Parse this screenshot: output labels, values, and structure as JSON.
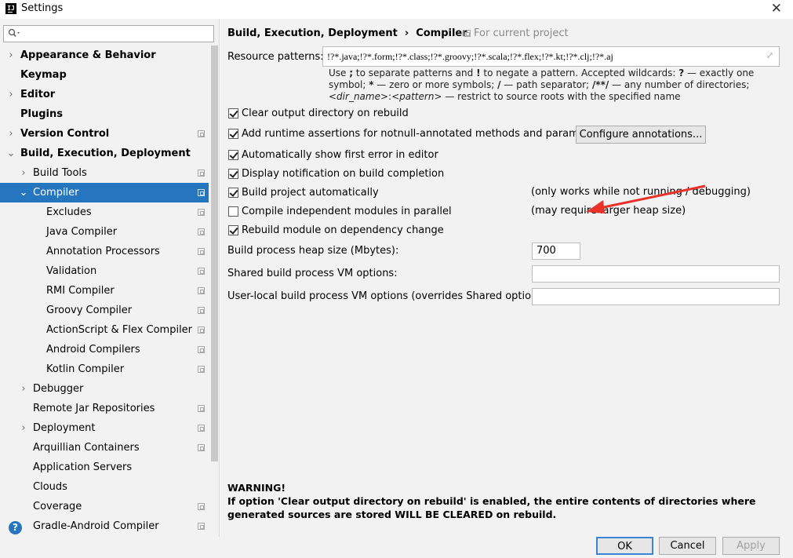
{
  "window": {
    "app_icon_text": "IJ",
    "title": "Settings",
    "close_glyph": "✕"
  },
  "search": {
    "placeholder": "",
    "value": ""
  },
  "tree": [
    {
      "label": "Appearance & Behavior",
      "bold": true,
      "arrow": "›",
      "level": 0,
      "project_icon": false
    },
    {
      "label": "Keymap",
      "bold": true,
      "arrow": "",
      "level": 0,
      "project_icon": false
    },
    {
      "label": "Editor",
      "bold": true,
      "arrow": "›",
      "level": 0,
      "project_icon": false
    },
    {
      "label": "Plugins",
      "bold": true,
      "arrow": "",
      "level": 0,
      "project_icon": false
    },
    {
      "label": "Version Control",
      "bold": true,
      "arrow": "›",
      "level": 0,
      "project_icon": true
    },
    {
      "label": "Build, Execution, Deployment",
      "bold": true,
      "arrow": "⌄",
      "level": 0,
      "project_icon": false
    },
    {
      "label": "Build Tools",
      "bold": false,
      "arrow": "›",
      "level": 1,
      "project_icon": true
    },
    {
      "label": "Compiler",
      "bold": false,
      "arrow": "⌄",
      "level": 1,
      "project_icon": true,
      "selected": true
    },
    {
      "label": "Excludes",
      "bold": false,
      "arrow": "",
      "level": 2,
      "project_icon": true
    },
    {
      "label": "Java Compiler",
      "bold": false,
      "arrow": "",
      "level": 2,
      "project_icon": true
    },
    {
      "label": "Annotation Processors",
      "bold": false,
      "arrow": "",
      "level": 2,
      "project_icon": true
    },
    {
      "label": "Validation",
      "bold": false,
      "arrow": "",
      "level": 2,
      "project_icon": true
    },
    {
      "label": "RMI Compiler",
      "bold": false,
      "arrow": "",
      "level": 2,
      "project_icon": true
    },
    {
      "label": "Groovy Compiler",
      "bold": false,
      "arrow": "",
      "level": 2,
      "project_icon": true
    },
    {
      "label": "ActionScript & Flex Compiler",
      "bold": false,
      "arrow": "",
      "level": 2,
      "project_icon": true
    },
    {
      "label": "Android Compilers",
      "bold": false,
      "arrow": "",
      "level": 2,
      "project_icon": true
    },
    {
      "label": "Kotlin Compiler",
      "bold": false,
      "arrow": "",
      "level": 2,
      "project_icon": true
    },
    {
      "label": "Debugger",
      "bold": false,
      "arrow": "›",
      "level": 1,
      "project_icon": false
    },
    {
      "label": "Remote Jar Repositories",
      "bold": false,
      "arrow": "",
      "level": 1,
      "project_icon": true
    },
    {
      "label": "Deployment",
      "bold": false,
      "arrow": "›",
      "level": 1,
      "project_icon": true
    },
    {
      "label": "Arquillian Containers",
      "bold": false,
      "arrow": "",
      "level": 1,
      "project_icon": true
    },
    {
      "label": "Application Servers",
      "bold": false,
      "arrow": "",
      "level": 1,
      "project_icon": false
    },
    {
      "label": "Clouds",
      "bold": false,
      "arrow": "",
      "level": 1,
      "project_icon": false
    },
    {
      "label": "Coverage",
      "bold": false,
      "arrow": "",
      "level": 1,
      "project_icon": true
    },
    {
      "label": "Gradle-Android Compiler",
      "bold": false,
      "arrow": "",
      "level": 1,
      "project_icon": true
    }
  ],
  "help": {
    "glyph": "?"
  },
  "header": {
    "crumb_parent": "Build, Execution, Deployment",
    "crumb_sep": "›",
    "crumb_current": "Compiler",
    "for_project": "For current project"
  },
  "resource": {
    "label": "Resource patterns:",
    "value": "!?*.java;!?*.form;!?*.class;!?*.groovy;!?*.scala;!?*.flex;!?*.kt;!?*.clj;!?*.aj",
    "expand_glyph": "⤢",
    "hint": {
      "p1": "Use ",
      "semicolon": ";",
      "p2": " to separate patterns and ",
      "bang": "!",
      "p3": " to negate a pattern. Accepted wildcards: ",
      "q": "?",
      "p4": " — exactly one symbol; ",
      "star": "*",
      "p5": " — zero or more symbols; ",
      "slash": "/",
      "p6": " — path separator; ",
      "dstar": "/**/",
      "p7": " — any number of directories; ",
      "dirname": "<dir_name>",
      "colon": ":",
      "pattern": "<pattern>",
      "p8": " — restrict to source roots with the specified name"
    }
  },
  "options": [
    {
      "label": "Clear output directory on rebuild",
      "checked": true,
      "note": ""
    },
    {
      "label": "Add runtime assertions for notnull-annotated methods and parameters",
      "checked": true,
      "note": ""
    },
    {
      "label": "Automatically show first error in editor",
      "checked": true,
      "note": ""
    },
    {
      "label": "Display notification on build completion",
      "checked": true,
      "note": ""
    },
    {
      "label": "Build project automatically",
      "checked": true,
      "note": "(only works while not running / debugging)"
    },
    {
      "label": "Compile independent modules in parallel",
      "checked": false,
      "note": "(may require larger heap size)"
    },
    {
      "label": "Rebuild module on dependency change",
      "checked": true,
      "note": ""
    }
  ],
  "configure_button": "Configure annotations...",
  "fields": {
    "heap_label": "Build process heap size (Mbytes):",
    "heap_value": "700",
    "shared_label": "Shared build process VM options:",
    "shared_value": "",
    "user_label": "User-local build process VM options (overrides Shared options):",
    "user_value": ""
  },
  "warning": {
    "title": "WARNING!",
    "text": "If option 'Clear output directory on rebuild' is enabled, the entire contents of directories where generated sources are stored WILL BE CLEARED on rebuild."
  },
  "footer": {
    "ok": "OK",
    "cancel": "Cancel",
    "apply": "Apply"
  },
  "annotation": {
    "arrow_color": "#e8322a"
  },
  "colors": {
    "selection": "#2675bf",
    "panel": "#f2f2f2",
    "accent": "#3a85d4"
  }
}
